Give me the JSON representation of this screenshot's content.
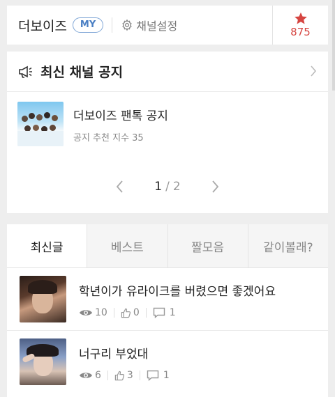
{
  "header": {
    "channel_name": "더보이즈",
    "my_badge": "MY",
    "settings_label": "채널설정",
    "star_count": "875",
    "star_icon": "star-icon",
    "accent_color": "#d64541"
  },
  "notice": {
    "title": "최신 채널 공지",
    "icon": "megaphone-icon",
    "items": [
      {
        "title": "더보이즈 팬톡 공지",
        "meta": "공지 추천 지수 35"
      }
    ],
    "pager": {
      "current": "1",
      "separator": "/",
      "total": "2"
    }
  },
  "tabs": [
    {
      "label": "최신글",
      "active": true
    },
    {
      "label": "베스트",
      "active": false
    },
    {
      "label": "짤모음",
      "active": false
    },
    {
      "label": "같이볼래?",
      "active": false
    }
  ],
  "posts": [
    {
      "title": "학년이가 유라이크를 버렸으면 좋겠어요",
      "views": "10",
      "likes": "0",
      "comments": "1"
    },
    {
      "title": "너구리 부었대",
      "views": "6",
      "likes": "3",
      "comments": "1"
    }
  ]
}
